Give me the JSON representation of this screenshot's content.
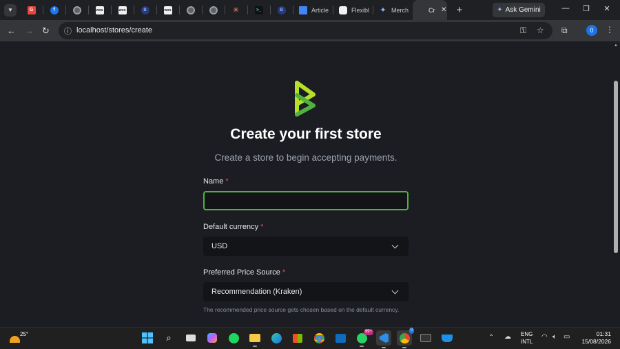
{
  "browser": {
    "tabs": [
      {
        "icon": "google-icon",
        "glyph": "G",
        "kind": "red",
        "label": ""
      },
      {
        "icon": "facebook-icon",
        "glyph": "f",
        "kind": "fb",
        "label": ""
      },
      {
        "icon": "globe-icon",
        "glyph": "",
        "kind": "globe",
        "label": ""
      },
      {
        "icon": "woocommerce-icon",
        "glyph": "woo",
        "kind": "wc",
        "label": ""
      },
      {
        "icon": "woocommerce-icon",
        "glyph": "woo",
        "kind": "wc",
        "label": ""
      },
      {
        "icon": "bitcoin-blue-icon",
        "glyph": "B",
        "kind": "blue",
        "label": ""
      },
      {
        "icon": "woocommerce-icon",
        "glyph": "woo",
        "kind": "wc",
        "label": ""
      },
      {
        "icon": "globe-icon",
        "glyph": "",
        "kind": "globe",
        "label": ""
      },
      {
        "icon": "globe-icon",
        "glyph": "",
        "kind": "globe",
        "label": ""
      },
      {
        "icon": "claude-star-icon",
        "glyph": "✳",
        "kind": "star",
        "label": ""
      },
      {
        "icon": "terminal-icon",
        "glyph": ">_",
        "kind": "term",
        "label": ""
      },
      {
        "icon": "bitcoin-blue-icon",
        "glyph": "B",
        "kind": "blue",
        "label": ""
      },
      {
        "icon": "docs-icon",
        "glyph": "",
        "kind": "doc",
        "label": "Article",
        "wide": true
      },
      {
        "icon": "flexible-icon",
        "glyph": "",
        "kind": "flex",
        "label": "Flexible",
        "wide": true
      },
      {
        "icon": "merchant-icon",
        "glyph": "✦",
        "kind": "merch",
        "label": "Merch",
        "wide": true
      },
      {
        "icon": "btcpay-icon",
        "glyph": "",
        "kind": "btc",
        "label": "Cr",
        "active": true
      }
    ],
    "close_tab_glyph": "✕",
    "new_tab_glyph": "+",
    "ask_gemini": "Ask Gemini",
    "url": "localhost/stores/create",
    "profile_initial": "0"
  },
  "page": {
    "title": "Create your first store",
    "subtitle": "Create a store to begin accepting payments.",
    "name_label": "Name",
    "name_value": "",
    "currency_label": "Default currency",
    "currency_value": "USD",
    "price_source_label": "Preferred Price Source",
    "price_source_value": "Recommendation (Kraken)",
    "help_text": "The recommended price source gets chosen based on the default currency.",
    "required_marker": "*"
  },
  "taskbar": {
    "temperature": "25°",
    "whatsapp_badge": "99+",
    "chrome_badge": "0",
    "lang_line1": "ENG",
    "lang_line2": "INTL",
    "time": "01:31",
    "date": "15/08/2026"
  },
  "colors": {
    "accent_green": "#51b13e",
    "logo_lime": "#b6e026",
    "required_red": "#e5534b"
  }
}
